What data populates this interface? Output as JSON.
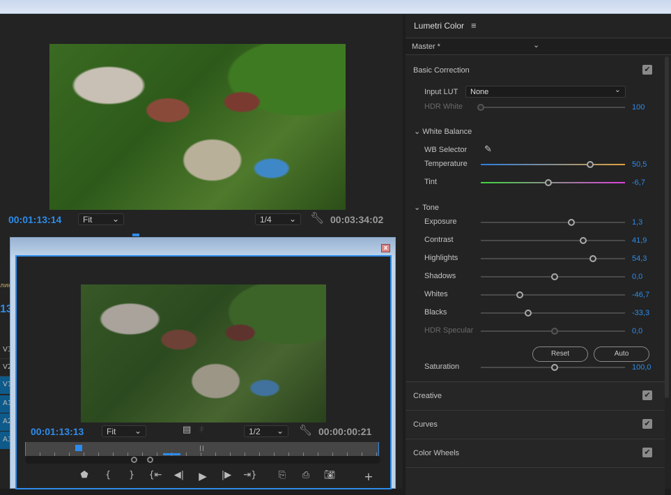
{
  "program": {
    "timecode": "00:01:13:14",
    "zoom": "Fit",
    "resolution": "1/4",
    "duration": "00:03:34:02"
  },
  "source": {
    "timecode": "00:01:13:13",
    "zoom": "Fit",
    "resolution": "1/2",
    "duration": "00:00:00:21",
    "close": "x",
    "playhead_fraction": 0.14
  },
  "timeline": {
    "label_partial": "лик",
    "timecode_partial": "13",
    "tracks": [
      "V3",
      "V2",
      "V1",
      "A1",
      "A2",
      "A3"
    ]
  },
  "lumetri": {
    "title": "Lumetri Color",
    "menu": "≡",
    "clip": "Master *",
    "basic": {
      "title": "Basic Correction",
      "input_lut_label": "Input LUT",
      "input_lut": "None",
      "hdr_white": {
        "label": "HDR White",
        "value": "100",
        "pos": 0
      },
      "white_balance": "White Balance",
      "wb_selector": "WB Selector",
      "temperature": {
        "label": "Temperature",
        "value": "50,5",
        "pos": 0.76
      },
      "tint": {
        "label": "Tint",
        "value": "-6,7",
        "pos": 0.47
      },
      "tone": "Tone",
      "sliders": [
        {
          "label": "Exposure",
          "value": "1,3",
          "pos": 0.63
        },
        {
          "label": "Contrast",
          "value": "41,9",
          "pos": 0.71
        },
        {
          "label": "Highlights",
          "value": "54,3",
          "pos": 0.78
        },
        {
          "label": "Shadows",
          "value": "0,0",
          "pos": 0.51
        },
        {
          "label": "Whites",
          "value": "-46,7",
          "pos": 0.27
        },
        {
          "label": "Blacks",
          "value": "-33,3",
          "pos": 0.33
        }
      ],
      "hdr_specular": {
        "label": "HDR Specular",
        "value": "0,0",
        "pos": 0.51
      },
      "reset": "Reset",
      "auto": "Auto",
      "saturation": {
        "label": "Saturation",
        "value": "100,0",
        "pos": 0.51
      }
    },
    "sections": [
      "Creative",
      "Curves",
      "Color Wheels"
    ]
  }
}
